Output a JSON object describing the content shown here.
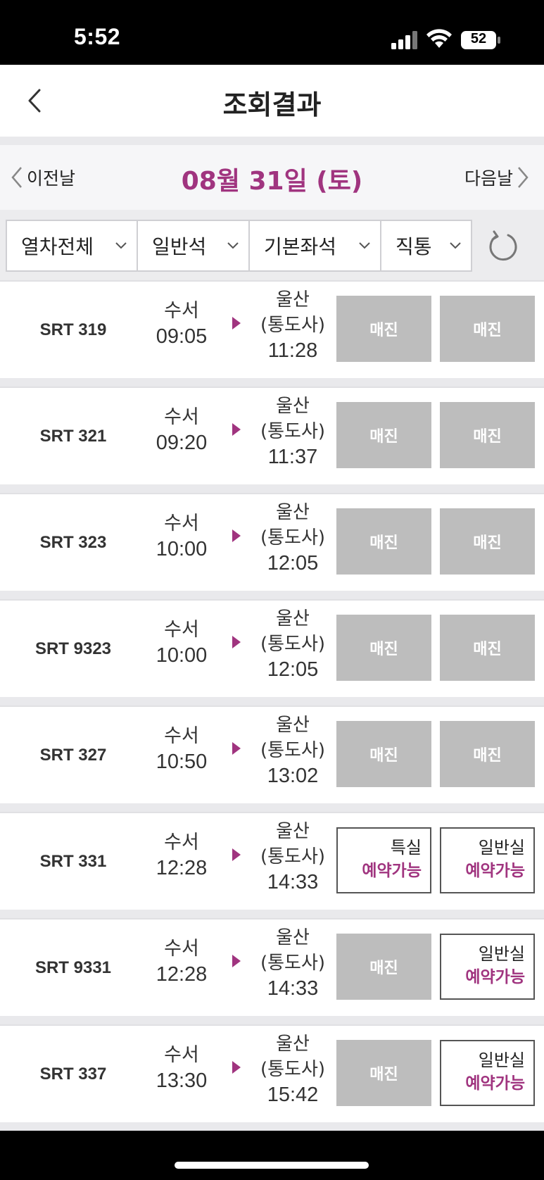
{
  "status_bar": {
    "time": "5:52",
    "battery": "52"
  },
  "header": {
    "title": "조회결과"
  },
  "date_nav": {
    "prev_label": "이전날",
    "date": "08월 31일 (토)",
    "next_label": "다음날"
  },
  "filters": [
    {
      "label": "열차전체"
    },
    {
      "label": "일반석"
    },
    {
      "label": "기본좌석"
    },
    {
      "label": "직통"
    }
  ],
  "results": [
    {
      "train": "SRT 319",
      "dep_station": "수서",
      "dep_time": "09:05",
      "arr_station": "울산",
      "arr_sub": "(통도사)",
      "arr_time": "11:28",
      "seat1": {
        "status": "매진"
      },
      "seat2": {
        "status": "매진"
      }
    },
    {
      "train": "SRT 321",
      "dep_station": "수서",
      "dep_time": "09:20",
      "arr_station": "울산",
      "arr_sub": "(통도사)",
      "arr_time": "11:37",
      "seat1": {
        "status": "매진"
      },
      "seat2": {
        "status": "매진"
      }
    },
    {
      "train": "SRT 323",
      "dep_station": "수서",
      "dep_time": "10:00",
      "arr_station": "울산",
      "arr_sub": "(통도사)",
      "arr_time": "12:05",
      "seat1": {
        "status": "매진"
      },
      "seat2": {
        "status": "매진"
      }
    },
    {
      "train": "SRT 9323",
      "dep_station": "수서",
      "dep_time": "10:00",
      "arr_station": "울산",
      "arr_sub": "(통도사)",
      "arr_time": "12:05",
      "seat1": {
        "status": "매진"
      },
      "seat2": {
        "status": "매진"
      }
    },
    {
      "train": "SRT 327",
      "dep_station": "수서",
      "dep_time": "10:50",
      "arr_station": "울산",
      "arr_sub": "(통도사)",
      "arr_time": "13:02",
      "seat1": {
        "status": "매진"
      },
      "seat2": {
        "status": "매진"
      }
    },
    {
      "train": "SRT 331",
      "dep_station": "수서",
      "dep_time": "12:28",
      "arr_station": "울산",
      "arr_sub": "(통도사)",
      "arr_time": "14:33",
      "seat1": {
        "class": "특실",
        "status": "예약가능"
      },
      "seat2": {
        "class": "일반실",
        "status": "예약가능"
      }
    },
    {
      "train": "SRT 9331",
      "dep_station": "수서",
      "dep_time": "12:28",
      "arr_station": "울산",
      "arr_sub": "(통도사)",
      "arr_time": "14:33",
      "seat1": {
        "status": "매진"
      },
      "seat2": {
        "class": "일반실",
        "status": "예약가능"
      }
    },
    {
      "train": "SRT 337",
      "dep_station": "수서",
      "dep_time": "13:30",
      "arr_station": "울산",
      "arr_sub": "(통도사)",
      "arr_time": "15:42",
      "seat1": {
        "status": "매진"
      },
      "seat2": {
        "class": "일반실",
        "status": "예약가능"
      }
    }
  ],
  "colors": {
    "accent": "#a0347f",
    "sold_out_bg": "#bdbdbd",
    "divider": "#e9e9ec"
  },
  "icons": {
    "back": "chevron-left-icon",
    "prev": "chevron-left-icon",
    "next": "chevron-right-icon",
    "filter": "chevron-down-icon",
    "refresh": "refresh-icon",
    "direction": "play-arrow-icon"
  }
}
